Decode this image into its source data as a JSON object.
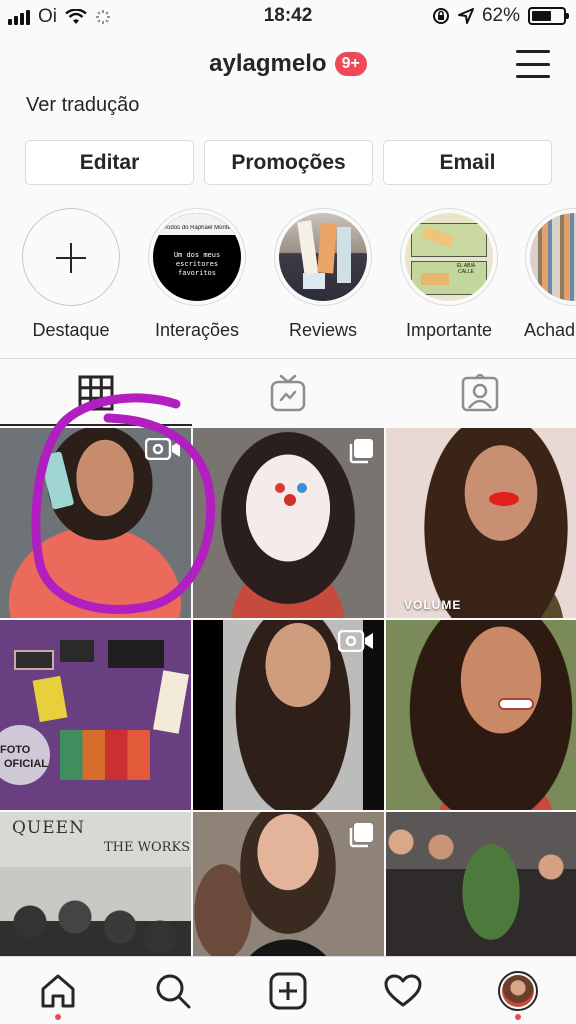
{
  "status_bar": {
    "carrier": "Oi",
    "time": "18:42",
    "battery": "62%",
    "battery_level": 0.62
  },
  "header": {
    "username": "aylagmelo",
    "notification_badge": "9+"
  },
  "profile": {
    "translate_link": "Ver tradução"
  },
  "actions": {
    "edit": "Editar",
    "promotions": "Promoções",
    "email": "Email"
  },
  "highlights": [
    {
      "label": "Destaque",
      "type": "new"
    },
    {
      "label": "Interações",
      "caption_top": "Todos do Raphael Montes",
      "caption_body": "Um dos meus escritores favoritos"
    },
    {
      "label": "Reviews"
    },
    {
      "label": "Importante",
      "comic_text": "EL ABIA CALLE"
    },
    {
      "label": "Achad"
    }
  ],
  "tabs": [
    {
      "name": "grid",
      "icon": "grid-icon",
      "active": true
    },
    {
      "name": "igtv",
      "icon": "igtv-icon",
      "active": false
    },
    {
      "name": "tagged",
      "icon": "tagged-icon",
      "active": false
    }
  ],
  "posts": [
    {
      "id": 1,
      "overlay": "video"
    },
    {
      "id": 2,
      "overlay": "multiple"
    },
    {
      "id": 3,
      "text": "VOLUME"
    },
    {
      "id": 4,
      "text_line1": "FOTO",
      "text_line2": "OFICIAL"
    },
    {
      "id": 5,
      "overlay": "video"
    },
    {
      "id": 6
    },
    {
      "id": 7,
      "text_line1": "QUEEN",
      "text_line2": "THE WORKS"
    },
    {
      "id": 8,
      "overlay": "multiple"
    },
    {
      "id": 9
    }
  ],
  "colors": {
    "accent": "#ed4956",
    "annotation_circle": "#b11fc0",
    "text": "#262626"
  },
  "bottom_nav": [
    "home-icon",
    "search-icon",
    "new-post-icon",
    "activity-icon",
    "profile-avatar"
  ]
}
